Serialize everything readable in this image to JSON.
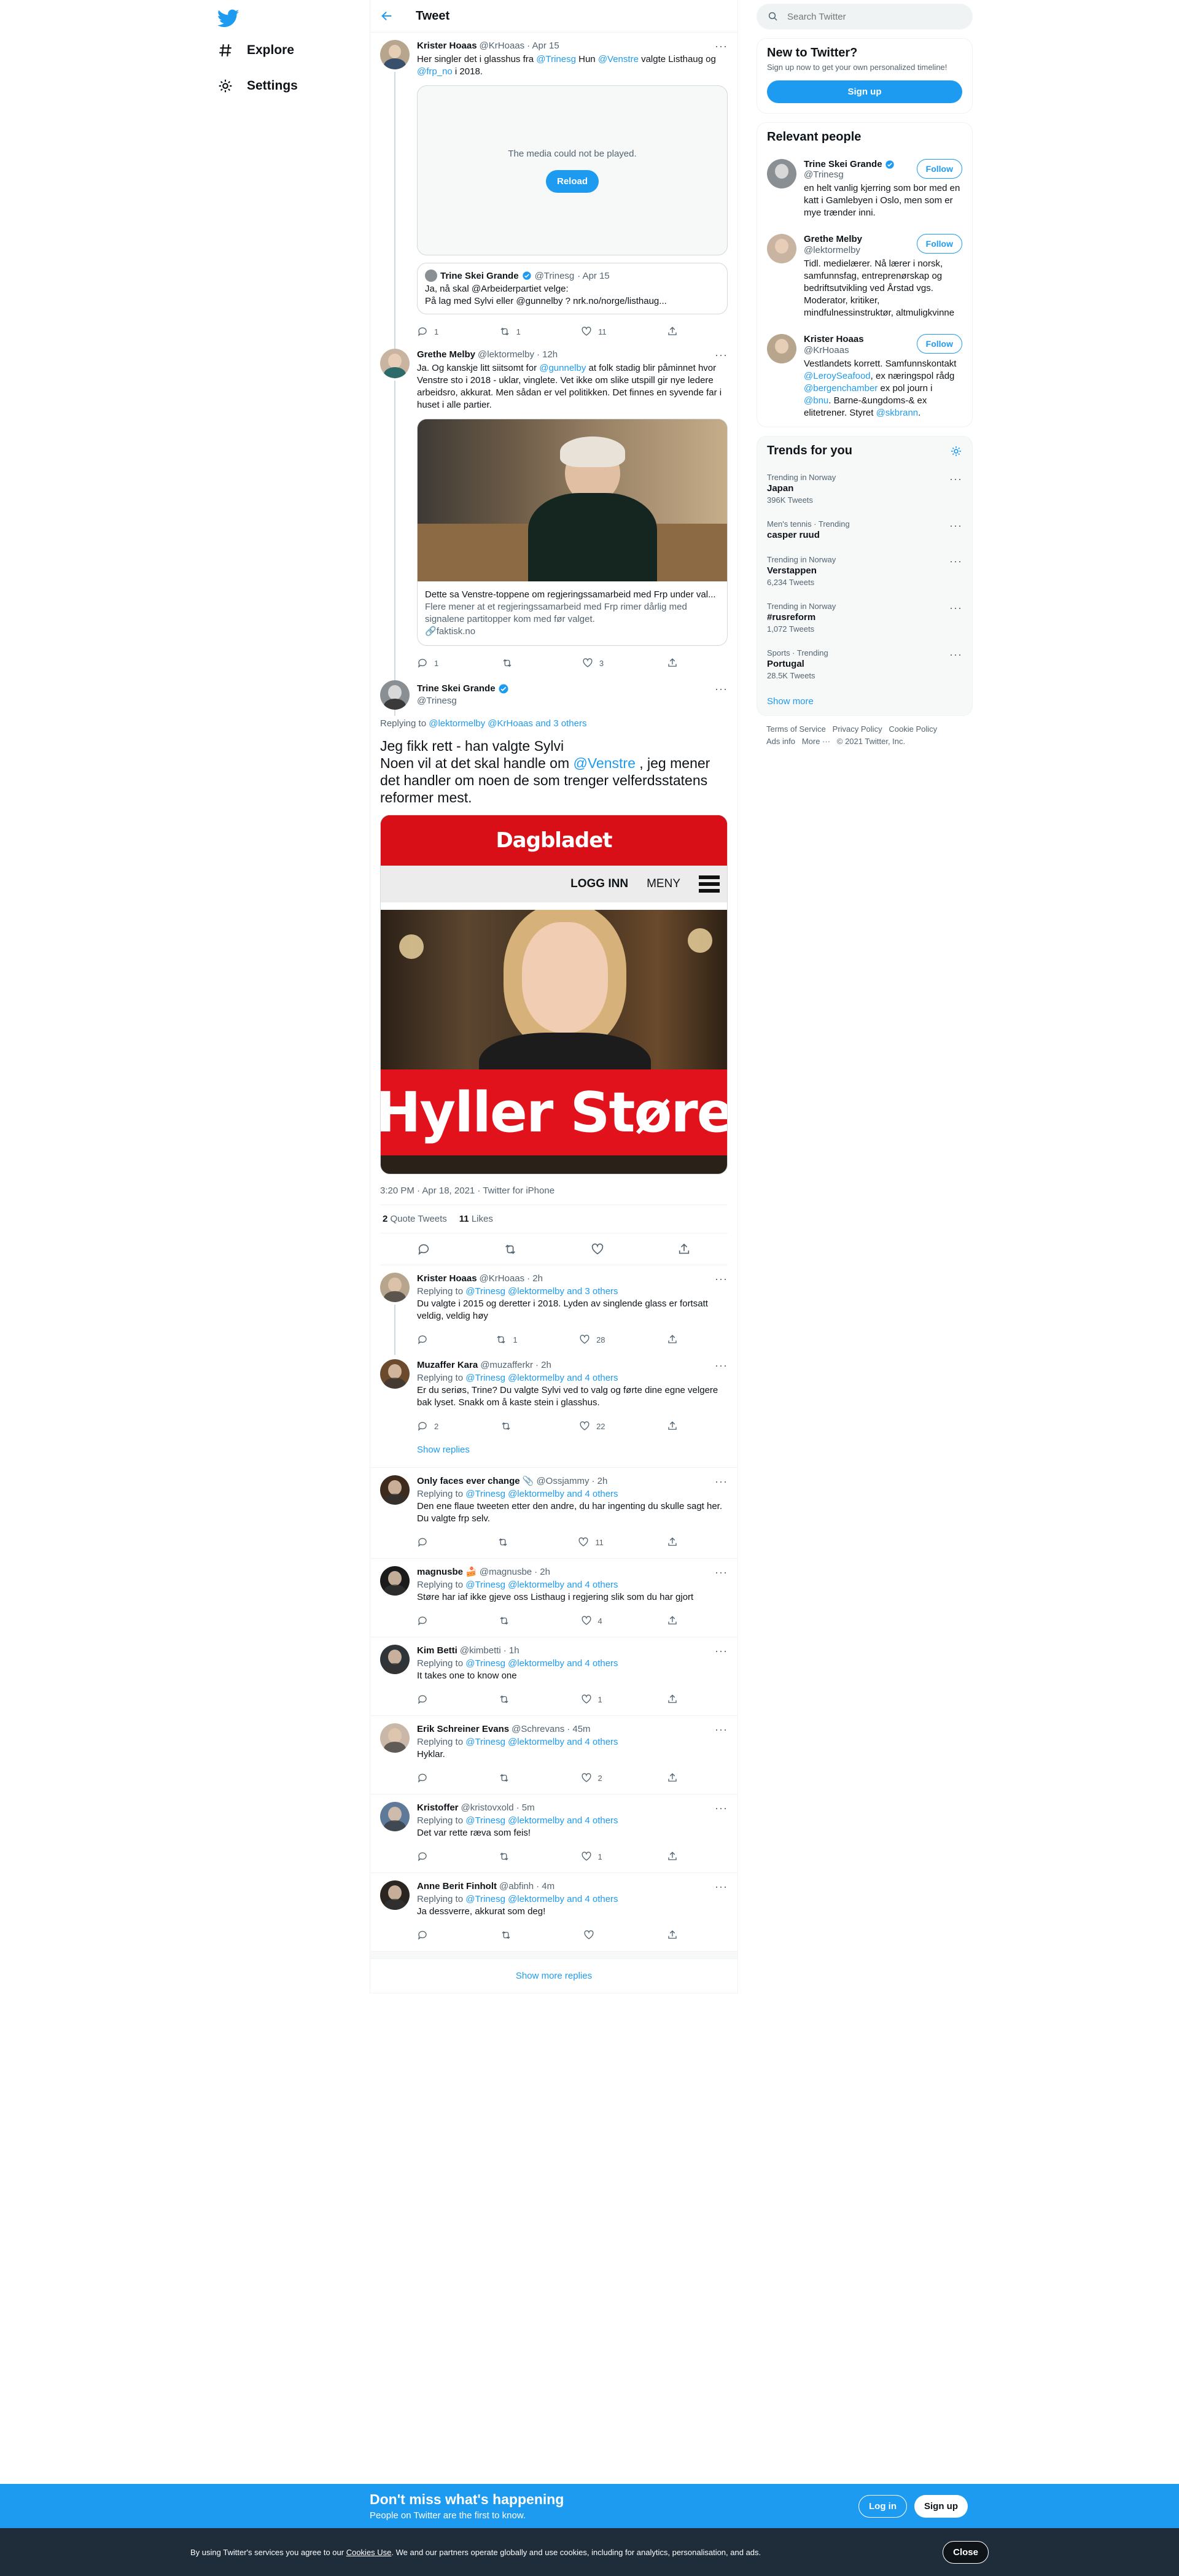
{
  "nav": {
    "explore": "Explore",
    "settings": "Settings"
  },
  "header": {
    "title": "Tweet"
  },
  "thread": {
    "t1": {
      "name": "Krister Hoaas",
      "handle": "@KrHoaas",
      "time": "· Apr 15",
      "text_a": "Her singler det i glasshus fra ",
      "m1": "@Trinesg",
      "text_b": " Hun ",
      "m2": "@Venstre",
      "text_c": " valgte Listhaug og ",
      "m3": "@frp_no",
      "text_d": " i 2018.",
      "media_msg": "The media could not be played.",
      "reload": "Reload",
      "quote": {
        "name": "Trine Skei Grande",
        "handle": "@Trinesg",
        "time": "· Apr 15",
        "text": "Ja, nå skal @Arbeiderpartiet velge:\nPå lag med Sylvi eller @gunnelby ?  nrk.no/norge/listhaug..."
      },
      "replies": "1",
      "retweets": "1",
      "likes": "11"
    },
    "t2": {
      "name": "Grethe Melby",
      "handle": "@lektormelby",
      "time": "· 12h",
      "text_a": "Ja. Og kanskje litt siitsomt for ",
      "m1": "@gunnelby",
      "text_b": " at folk stadig blir påminnet hvor Venstre sto i 2018 - uklar, vinglete. Vet ikke om slike utspill gir nye ledere arbeidsro, akkurat. Men sådan er vel politikken. Det finnes en syvende far i huset i alle partier.",
      "card_title": "Dette sa Venstre-toppene om regjeringssamarbeid med Frp under val...",
      "card_desc": "Flere mener at et regjeringssamarbeid med Frp rimer dårlig med signalene partitopper kom med før valget.",
      "card_domain": "faktisk.no",
      "replies": "1",
      "retweets": "",
      "likes": "3"
    },
    "main": {
      "name": "Trine Skei Grande",
      "handle": "@Trinesg",
      "replying": "Replying to ",
      "rt": "@lektormelby @KrHoaas and 3 others",
      "text_a": "Jeg fikk rett - han valgte Sylvi\nNoen vil at det skal handle om ",
      "m1": "@Venstre",
      "text_b": " , jeg mener det handler om noen de som trenger velferdsstatens reformer mest.",
      "img_brand": "Dagbladet",
      "img_login": "LOGG INN",
      "img_menu": "MENY",
      "img_headline": "Hyller Støre",
      "meta": "3:20 PM · Apr 18, 2021 · Twitter for iPhone",
      "quote_count": "2",
      "quote_label": "Quote Tweets",
      "like_count": "11",
      "like_label": "Likes"
    }
  },
  "replies": [
    {
      "name": "Krister Hoaas",
      "handle": "@KrHoaas",
      "time": "· 2h",
      "to": "@Trinesg @lektormelby and 3 others",
      "text": "Du valgte i 2015 og deretter i 2018. Lyden av singlende glass er fortsatt veldig, veldig høy",
      "r": "",
      "rt": "1",
      "l": "28",
      "av": "#b7a58d"
    },
    {
      "name": "Muzaffer Kara",
      "handle": "@muzafferkr",
      "time": "· 2h",
      "to": "@Trinesg @lektormelby and 4 others",
      "text": "Er du seriøs, Trine? Du valgte Sylvi ved to valg og førte dine egne velgere bak lyset. Snakk om å kaste stein i glasshus.",
      "r": "2",
      "rt": "",
      "l": "22",
      "av": "#6b4a2e"
    },
    {
      "name": "Only faces ever change 📎",
      "handle": "@Ossjammy",
      "time": "· 2h",
      "to": "@Trinesg @lektormelby and 4 others",
      "text": "Den ene flaue tweeten etter den andre, du har ingenting du skulle sagt her. Du valgte frp selv.",
      "r": "",
      "rt": "",
      "l": "11",
      "av": "#3e2b1e"
    },
    {
      "name": "magnusbe 🍰",
      "handle": "@magnusbe",
      "time": "· 2h",
      "to": "@Trinesg @lektormelby and 4 others",
      "text": "Støre har iaf ikke gjeve oss Listhaug i regjering slik  som du har gjort",
      "r": "",
      "rt": "",
      "l": "4",
      "av": "#1b1b1b"
    },
    {
      "name": "Kim Betti",
      "handle": "@kimbetti",
      "time": "· 1h",
      "to": "@Trinesg @lektormelby and 4 others",
      "text": "It takes one to know one",
      "r": "",
      "rt": "",
      "l": "1",
      "av": "#2f3439"
    },
    {
      "name": "Erik Schreiner Evans",
      "handle": "@Schrevans",
      "time": "· 45m",
      "to": "@Trinesg @lektormelby and 4 others",
      "text": "Hyklar.",
      "r": "",
      "rt": "",
      "l": "2",
      "av": "#c9b8a8"
    },
    {
      "name": "Kristoffer",
      "handle": "@kristovxold",
      "time": "· 5m",
      "to": "@Trinesg @lektormelby and 4 others",
      "text": "Det var rette ræva som feis!",
      "r": "",
      "rt": "",
      "l": "1",
      "av": "#5f7a99"
    },
    {
      "name": "Anne Berit Finholt",
      "handle": "@abfinh",
      "time": "· 4m",
      "to": "@Trinesg @lektormelby and 4 others",
      "text": "Ja dessverre, akkurat som deg!",
      "r": "",
      "rt": "",
      "l": "",
      "av": "#2a2520"
    }
  ],
  "show_replies": "Show replies",
  "show_more_replies": "Show more replies",
  "sidebar": {
    "search_placeholder": "Search Twitter",
    "new_title": "New to Twitter?",
    "new_sub": "Sign up now to get your own personalized timeline!",
    "signup": "Sign up",
    "relevant_title": "Relevant people",
    "follow": "Follow",
    "people": [
      {
        "name": "Trine Skei Grande",
        "handle": "@Trinesg",
        "bio": "en helt vanlig kjerring som bor med en katt i Gamlebyen i Oslo, men som er mye trænder inni."
      },
      {
        "name": "Grethe Melby",
        "handle": "@lektormelby",
        "bio": "Tidl. medielærer. Nå lærer i norsk, samfunnsfag, entreprenørskap og bedriftsutvikling ved Årstad vgs. Moderator, kritiker, mindfulnessinstruktør, altmuligkvinne"
      },
      {
        "name": "Krister Hoaas",
        "handle": "@KrHoaas",
        "bio_a": "Vestlandets korrett. Samfunnskontakt ",
        "bio_m1": "@LeroySeafood",
        "bio_b": ", ex næringspol rådg ",
        "bio_m2": "@bergenchamber",
        "bio_c": " ex pol journ i ",
        "bio_m3": "@bnu",
        "bio_d": ". Barne-&ungdoms-& ex elitetrener. Styret ",
        "bio_m4": "@skbrann",
        "bio_e": "."
      }
    ],
    "trends_title": "Trends for you",
    "trends": [
      {
        "cat": "Trending in Norway",
        "name": "Japan",
        "count": "396K Tweets"
      },
      {
        "cat": "Men's tennis · Trending",
        "name": "casper ruud",
        "count": ""
      },
      {
        "cat": "Trending in Norway",
        "name": "Verstappen",
        "count": "6,234 Tweets"
      },
      {
        "cat": "Trending in Norway",
        "name": "#rusreform",
        "count": "1,072 Tweets"
      },
      {
        "cat": "Sports · Trending",
        "name": "Portugal",
        "count": "28.5K Tweets"
      }
    ],
    "show_more": "Show more",
    "footer": [
      "Terms of Service",
      "Privacy Policy",
      "Cookie Policy",
      "Ads info",
      "More ···",
      "© 2021 Twitter, Inc."
    ]
  },
  "bottom": {
    "title": "Don't miss what's happening",
    "sub": "People on Twitter are the first to know.",
    "login": "Log in",
    "signup": "Sign up"
  },
  "cookie": {
    "pre": "By using Twitter's services you agree to our ",
    "link": "Cookies Use",
    "post": ". We and our partners operate globally and use cookies, including for analytics, personalisation, and ads.",
    "close": "Close"
  }
}
